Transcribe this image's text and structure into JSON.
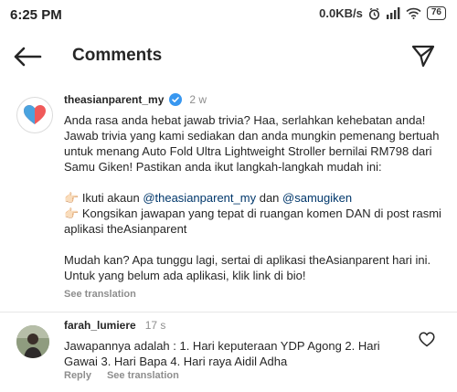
{
  "status_bar": {
    "time": "6:25 PM",
    "network_speed": "0.0KB/s",
    "battery": "76",
    "icons": [
      "alarm-icon",
      "signal-icon",
      "wifi-icon",
      "battery-icon"
    ]
  },
  "header": {
    "title": "Comments",
    "back_icon": "back-arrow-icon",
    "send_icon": "paper-plane-icon"
  },
  "caption": {
    "username": "theasianparent_my",
    "verified": true,
    "time_ago": "2 w",
    "paragraph1": "Anda rasa anda hebat jawab trivia? Haa, serlahkan kehebatan anda! Jawab trivia yang kami sediakan dan anda mungkin pemenang bertuah untuk menang Auto Fold Ultra Lightweight Stroller bernilai RM798 dari Samu Giken! Pastikan anda ikut langkah-langkah mudah ini:",
    "step1_emoji": "👉🏻",
    "step1_text": "Ikuti akaun",
    "step1_mention1": "@theasianparent_my",
    "step1_and": "dan",
    "step1_mention2": "@samugiken",
    "step2_emoji": "👉🏻",
    "step2_text": "Kongsikan jawapan yang tepat di ruangan komen DAN di post rasmi aplikasi theAsianparent",
    "paragraph3": "Mudah kan? Apa tunggu lagi, sertai di aplikasi theAsianparent hari ini. Untuk yang belum ada aplikasi, klik link di bio!",
    "see_translation": "See translation"
  },
  "comment": {
    "username": "farah_lumiere",
    "time_ago": "17 s",
    "text": "Jawapannya adalah : 1. Hari keputeraan YDP Agong 2. Hari Gawai 3. Hari Bapa 4. Hari raya Aidil Adha",
    "reply_label": "Reply",
    "see_translation": "See translation",
    "like_icon": "heart-outline-icon"
  },
  "colors": {
    "text": "#262626",
    "secondary": "#8e8e8e",
    "mention": "#00376b",
    "verified": "#3897f0"
  }
}
